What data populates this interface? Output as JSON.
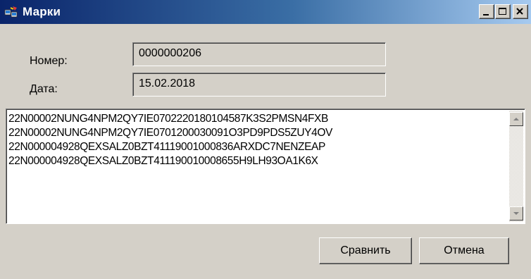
{
  "window": {
    "title": "Марки",
    "icon": "marks-app-icon"
  },
  "form": {
    "number_label": "Номер:",
    "number_value": "0000000206",
    "date_label": "Дата:",
    "date_value": "15.02.2018"
  },
  "memo": {
    "lines": [
      "22N00002NUNG4NPM2QY7IE0702220180104587K3S2PMSN4FXB",
      "22N00002NUNG4NPM2QY7IE0701200030091O3PD9PDS5ZUY4OV",
      "22N000004928QEXSALZ0BZT41119001000836ARXDC7NENZEAP",
      "22N000004928QEXSALZ0BZT411190010008655H9LH93OA1K6X"
    ]
  },
  "buttons": {
    "compare": "Сравнить",
    "cancel": "Отмена"
  },
  "icons": [
    "minimize-icon",
    "maximize-icon",
    "close-icon",
    "scroll-up-icon",
    "scroll-down-icon"
  ],
  "colors": {
    "titlebar_start": "#0a246a",
    "titlebar_end": "#a6caf0",
    "window_bg": "#d4d0c8"
  }
}
